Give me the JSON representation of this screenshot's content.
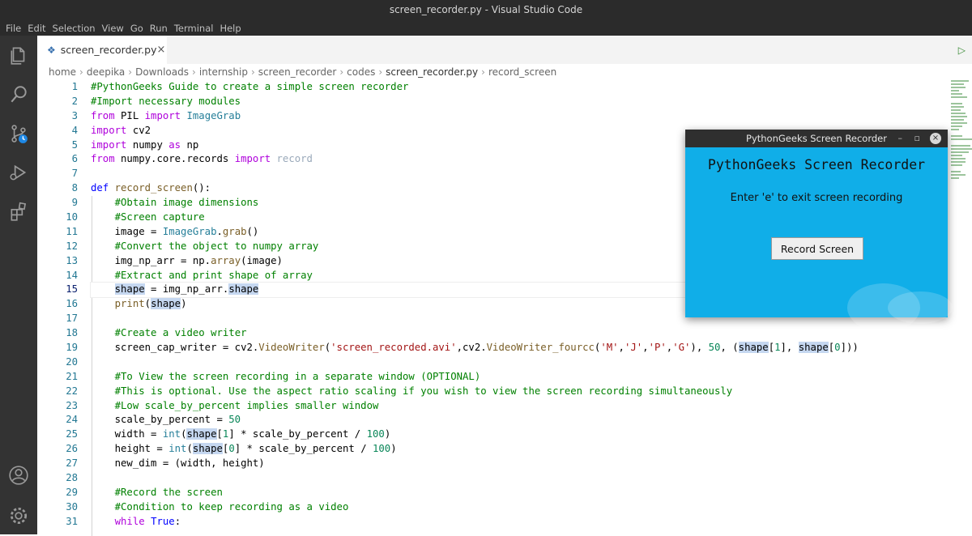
{
  "window": {
    "title": "screen_recorder.py - Visual Studio Code"
  },
  "menu": {
    "items": [
      "File",
      "Edit",
      "Selection",
      "View",
      "Go",
      "Run",
      "Terminal",
      "Help"
    ]
  },
  "tab": {
    "name": "screen_recorder.py",
    "close": "×",
    "file_icon": "python-file-icon"
  },
  "breadcrumb": {
    "items": [
      "home",
      "deepika",
      "Downloads",
      "internship",
      "screen_recorder",
      "codes",
      "screen_recorder.py",
      "record_screen"
    ],
    "separator": "›"
  },
  "editor": {
    "current_line": 15,
    "colors": {
      "comment": "#008000",
      "keyword": "#af00db",
      "def": "#0000ff",
      "string": "#a31515",
      "number": "#098658"
    },
    "lines": [
      [
        [
          "#PythonGeeks Guide to create a simple screen recorder",
          "com"
        ]
      ],
      [
        [
          "#Import necessary modules",
          "com"
        ]
      ],
      [
        [
          "from",
          "kw"
        ],
        [
          " PIL ",
          ""
        ],
        [
          "import",
          "kw"
        ],
        [
          " ",
          ""
        ],
        [
          "ImageGrab",
          "cls"
        ]
      ],
      [
        [
          "import",
          "kw"
        ],
        [
          " cv2",
          ""
        ]
      ],
      [
        [
          "import",
          "kw"
        ],
        [
          " numpy ",
          ""
        ],
        [
          "as",
          "kw"
        ],
        [
          " np",
          ""
        ]
      ],
      [
        [
          "from",
          "kw"
        ],
        [
          " numpy.core.records ",
          ""
        ],
        [
          "import",
          "kw"
        ],
        [
          " ",
          ""
        ],
        [
          "record",
          "dim"
        ]
      ],
      [
        [
          "",
          ""
        ]
      ],
      [
        [
          "def",
          "def"
        ],
        [
          " ",
          ""
        ],
        [
          "record_screen",
          "fn"
        ],
        [
          "():",
          ""
        ]
      ],
      [
        [
          "    ",
          ""
        ],
        [
          "#Obtain image dimensions",
          "com"
        ]
      ],
      [
        [
          "    ",
          ""
        ],
        [
          "#Screen capture",
          "com"
        ]
      ],
      [
        [
          "    image = ",
          ""
        ],
        [
          "ImageGrab",
          "cls"
        ],
        [
          ".",
          ""
        ],
        [
          "grab",
          "fn"
        ],
        [
          "()",
          ""
        ]
      ],
      [
        [
          "    ",
          ""
        ],
        [
          "#Convert the object to numpy array",
          "com"
        ]
      ],
      [
        [
          "    img_np_arr = np.",
          ""
        ],
        [
          "array",
          "fn"
        ],
        [
          "(image)",
          ""
        ]
      ],
      [
        [
          "    ",
          ""
        ],
        [
          "#Extract and print shape of array",
          "com"
        ]
      ],
      [
        [
          "    ",
          ""
        ],
        [
          "shape",
          "hl"
        ],
        [
          " = img_np_arr.",
          ""
        ],
        [
          "shape",
          "hl"
        ]
      ],
      [
        [
          "    ",
          ""
        ],
        [
          "print",
          "fn"
        ],
        [
          "(",
          ""
        ],
        [
          "shape",
          "hl"
        ],
        [
          ")",
          ""
        ]
      ],
      [
        [
          "",
          ""
        ]
      ],
      [
        [
          "    ",
          ""
        ],
        [
          "#Create a video writer",
          "com"
        ]
      ],
      [
        [
          "    screen_cap_writer = cv2.",
          ""
        ],
        [
          "VideoWriter",
          "fn"
        ],
        [
          "(",
          ""
        ],
        [
          "'screen_recorded.avi'",
          "str"
        ],
        [
          ",cv2.",
          ""
        ],
        [
          "VideoWriter_fourcc",
          "fn"
        ],
        [
          "(",
          ""
        ],
        [
          "'M'",
          "str"
        ],
        [
          ",",
          ""
        ],
        [
          "'J'",
          "str"
        ],
        [
          ",",
          ""
        ],
        [
          "'P'",
          "str"
        ],
        [
          ",",
          ""
        ],
        [
          "'G'",
          "str"
        ],
        [
          "), ",
          ""
        ],
        [
          "50",
          "num"
        ],
        [
          ", (",
          ""
        ],
        [
          "shape",
          "hl"
        ],
        [
          "[",
          ""
        ],
        [
          "1",
          "num"
        ],
        [
          "], ",
          ""
        ],
        [
          "shape",
          "hl"
        ],
        [
          "[",
          ""
        ],
        [
          "0",
          "num"
        ],
        [
          "]))",
          ""
        ]
      ],
      [
        [
          "",
          ""
        ]
      ],
      [
        [
          "    ",
          ""
        ],
        [
          "#To View the screen recording in a separate window (OPTIONAL)",
          "com"
        ]
      ],
      [
        [
          "    ",
          ""
        ],
        [
          "#This is optional. Use the aspect ratio scaling if you wish to view the screen recording simultaneously",
          "com"
        ]
      ],
      [
        [
          "    ",
          ""
        ],
        [
          "#Low scale_by_percent implies smaller window",
          "com"
        ]
      ],
      [
        [
          "    scale_by_percent = ",
          ""
        ],
        [
          "50",
          "num"
        ]
      ],
      [
        [
          "    width = ",
          ""
        ],
        [
          "int",
          "cls"
        ],
        [
          "(",
          ""
        ],
        [
          "shape",
          "hl"
        ],
        [
          "[",
          ""
        ],
        [
          "1",
          "num"
        ],
        [
          "] * scale_by_percent / ",
          ""
        ],
        [
          "100",
          "num"
        ],
        [
          ")",
          ""
        ]
      ],
      [
        [
          "    height = ",
          ""
        ],
        [
          "int",
          "cls"
        ],
        [
          "(",
          ""
        ],
        [
          "shape",
          "hl"
        ],
        [
          "[",
          ""
        ],
        [
          "0",
          "num"
        ],
        [
          "] * scale_by_percent / ",
          ""
        ],
        [
          "100",
          "num"
        ],
        [
          ")",
          ""
        ]
      ],
      [
        [
          "    new_dim = (width, height)",
          ""
        ]
      ],
      [
        [
          "",
          ""
        ]
      ],
      [
        [
          "    ",
          ""
        ],
        [
          "#Record the screen",
          "com"
        ]
      ],
      [
        [
          "    ",
          ""
        ],
        [
          "#Condition to keep recording as a video",
          "com"
        ]
      ],
      [
        [
          "    ",
          ""
        ],
        [
          "while",
          "kw"
        ],
        [
          " ",
          ""
        ],
        [
          "True",
          "def"
        ],
        [
          ":",
          ""
        ]
      ]
    ]
  },
  "dialog": {
    "title": "PythonGeeks Screen Recorder",
    "heading": "PythonGeeks Screen Recorder",
    "instruction": "Enter 'e' to exit screen recording",
    "button": "Record Screen",
    "close": "×",
    "minimize": "–",
    "maximize": "▫",
    "background": "#10aee8"
  },
  "activity_icons": [
    "explorer-icon",
    "search-icon",
    "source-control-icon",
    "run-debug-icon",
    "extensions-icon",
    "account-icon",
    "settings-gear-icon"
  ]
}
